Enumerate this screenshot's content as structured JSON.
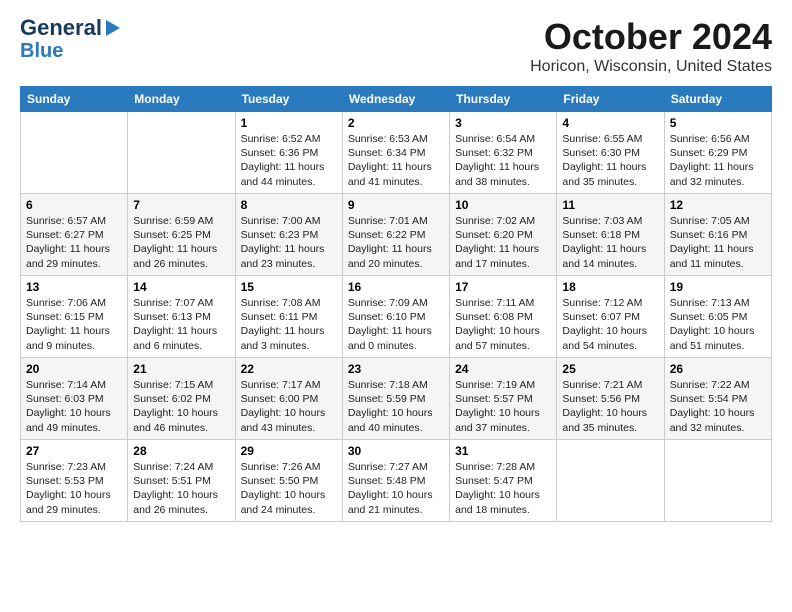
{
  "logo": {
    "line1": "General",
    "line2": "Blue"
  },
  "header": {
    "month": "October 2024",
    "location": "Horicon, Wisconsin, United States"
  },
  "days_of_week": [
    "Sunday",
    "Monday",
    "Tuesday",
    "Wednesday",
    "Thursday",
    "Friday",
    "Saturday"
  ],
  "weeks": [
    [
      {
        "day": "",
        "content": ""
      },
      {
        "day": "",
        "content": ""
      },
      {
        "day": "1",
        "content": "Sunrise: 6:52 AM\nSunset: 6:36 PM\nDaylight: 11 hours and 44 minutes."
      },
      {
        "day": "2",
        "content": "Sunrise: 6:53 AM\nSunset: 6:34 PM\nDaylight: 11 hours and 41 minutes."
      },
      {
        "day": "3",
        "content": "Sunrise: 6:54 AM\nSunset: 6:32 PM\nDaylight: 11 hours and 38 minutes."
      },
      {
        "day": "4",
        "content": "Sunrise: 6:55 AM\nSunset: 6:30 PM\nDaylight: 11 hours and 35 minutes."
      },
      {
        "day": "5",
        "content": "Sunrise: 6:56 AM\nSunset: 6:29 PM\nDaylight: 11 hours and 32 minutes."
      }
    ],
    [
      {
        "day": "6",
        "content": "Sunrise: 6:57 AM\nSunset: 6:27 PM\nDaylight: 11 hours and 29 minutes."
      },
      {
        "day": "7",
        "content": "Sunrise: 6:59 AM\nSunset: 6:25 PM\nDaylight: 11 hours and 26 minutes."
      },
      {
        "day": "8",
        "content": "Sunrise: 7:00 AM\nSunset: 6:23 PM\nDaylight: 11 hours and 23 minutes."
      },
      {
        "day": "9",
        "content": "Sunrise: 7:01 AM\nSunset: 6:22 PM\nDaylight: 11 hours and 20 minutes."
      },
      {
        "day": "10",
        "content": "Sunrise: 7:02 AM\nSunset: 6:20 PM\nDaylight: 11 hours and 17 minutes."
      },
      {
        "day": "11",
        "content": "Sunrise: 7:03 AM\nSunset: 6:18 PM\nDaylight: 11 hours and 14 minutes."
      },
      {
        "day": "12",
        "content": "Sunrise: 7:05 AM\nSunset: 6:16 PM\nDaylight: 11 hours and 11 minutes."
      }
    ],
    [
      {
        "day": "13",
        "content": "Sunrise: 7:06 AM\nSunset: 6:15 PM\nDaylight: 11 hours and 9 minutes."
      },
      {
        "day": "14",
        "content": "Sunrise: 7:07 AM\nSunset: 6:13 PM\nDaylight: 11 hours and 6 minutes."
      },
      {
        "day": "15",
        "content": "Sunrise: 7:08 AM\nSunset: 6:11 PM\nDaylight: 11 hours and 3 minutes."
      },
      {
        "day": "16",
        "content": "Sunrise: 7:09 AM\nSunset: 6:10 PM\nDaylight: 11 hours and 0 minutes."
      },
      {
        "day": "17",
        "content": "Sunrise: 7:11 AM\nSunset: 6:08 PM\nDaylight: 10 hours and 57 minutes."
      },
      {
        "day": "18",
        "content": "Sunrise: 7:12 AM\nSunset: 6:07 PM\nDaylight: 10 hours and 54 minutes."
      },
      {
        "day": "19",
        "content": "Sunrise: 7:13 AM\nSunset: 6:05 PM\nDaylight: 10 hours and 51 minutes."
      }
    ],
    [
      {
        "day": "20",
        "content": "Sunrise: 7:14 AM\nSunset: 6:03 PM\nDaylight: 10 hours and 49 minutes."
      },
      {
        "day": "21",
        "content": "Sunrise: 7:15 AM\nSunset: 6:02 PM\nDaylight: 10 hours and 46 minutes."
      },
      {
        "day": "22",
        "content": "Sunrise: 7:17 AM\nSunset: 6:00 PM\nDaylight: 10 hours and 43 minutes."
      },
      {
        "day": "23",
        "content": "Sunrise: 7:18 AM\nSunset: 5:59 PM\nDaylight: 10 hours and 40 minutes."
      },
      {
        "day": "24",
        "content": "Sunrise: 7:19 AM\nSunset: 5:57 PM\nDaylight: 10 hours and 37 minutes."
      },
      {
        "day": "25",
        "content": "Sunrise: 7:21 AM\nSunset: 5:56 PM\nDaylight: 10 hours and 35 minutes."
      },
      {
        "day": "26",
        "content": "Sunrise: 7:22 AM\nSunset: 5:54 PM\nDaylight: 10 hours and 32 minutes."
      }
    ],
    [
      {
        "day": "27",
        "content": "Sunrise: 7:23 AM\nSunset: 5:53 PM\nDaylight: 10 hours and 29 minutes."
      },
      {
        "day": "28",
        "content": "Sunrise: 7:24 AM\nSunset: 5:51 PM\nDaylight: 10 hours and 26 minutes."
      },
      {
        "day": "29",
        "content": "Sunrise: 7:26 AM\nSunset: 5:50 PM\nDaylight: 10 hours and 24 minutes."
      },
      {
        "day": "30",
        "content": "Sunrise: 7:27 AM\nSunset: 5:48 PM\nDaylight: 10 hours and 21 minutes."
      },
      {
        "day": "31",
        "content": "Sunrise: 7:28 AM\nSunset: 5:47 PM\nDaylight: 10 hours and 18 minutes."
      },
      {
        "day": "",
        "content": ""
      },
      {
        "day": "",
        "content": ""
      }
    ]
  ]
}
